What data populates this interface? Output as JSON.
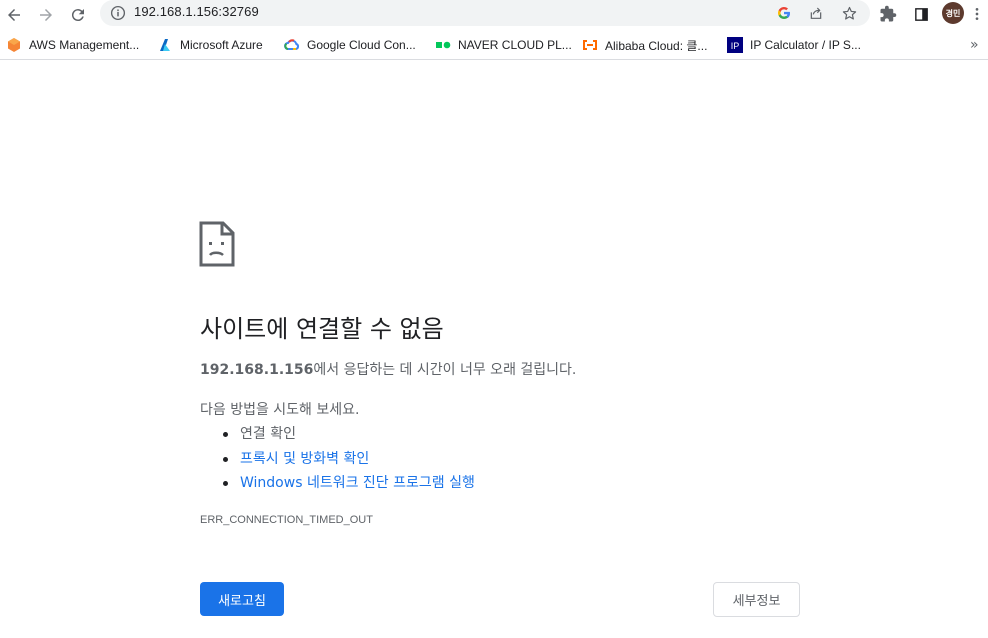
{
  "browser": {
    "url": "192.168.1.156:32769",
    "profile_initials": "경민"
  },
  "bookmarks": [
    {
      "icon": "aws-icon",
      "label": "AWS Management..."
    },
    {
      "icon": "azure-icon",
      "label": "Microsoft Azure"
    },
    {
      "icon": "google-cloud-icon",
      "label": "Google Cloud Con..."
    },
    {
      "icon": "naver-cloud-icon",
      "label": "NAVER CLOUD PL..."
    },
    {
      "icon": "alibaba-cloud-icon",
      "label": "Alibaba Cloud: 클..."
    },
    {
      "icon": "ip-calculator-icon",
      "label": "IP Calculator / IP S..."
    }
  ],
  "error": {
    "title": "사이트에 연결할 수 없음",
    "host": "192.168.1.156",
    "description": "에서 응답하는 데 시간이 너무 오래 걸립니다.",
    "try_heading": "다음 방법을 시도해 보세요.",
    "suggestions": [
      "연결 확인",
      "프록시 및 방화벽 확인",
      "Windows 네트워크 진단 프로그램 실행"
    ],
    "code": "ERR_CONNECTION_TIMED_OUT"
  },
  "buttons": {
    "reload": "새로고침",
    "details": "세부정보"
  },
  "colors": {
    "accent": "#1a73e8",
    "text_secondary": "#5f6368",
    "omnibox_bg": "#f1f3f4"
  }
}
